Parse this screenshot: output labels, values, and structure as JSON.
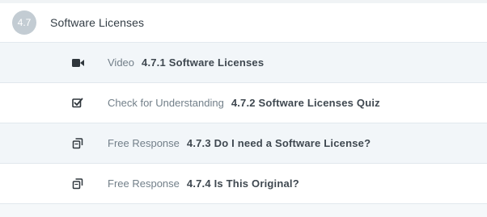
{
  "section": {
    "number": "4.7",
    "title": "Software Licenses"
  },
  "items": [
    {
      "icon": "video-camera-icon",
      "type": "Video",
      "title": "4.7.1 Software Licenses"
    },
    {
      "icon": "checkbox-icon",
      "type": "Check for Understanding",
      "title": "4.7.2 Software Licenses Quiz"
    },
    {
      "icon": "copy-pages-icon",
      "type": "Free Response",
      "title": "4.7.3 Do I need a Software License?"
    },
    {
      "icon": "copy-pages-icon",
      "type": "Free Response",
      "title": "4.7.4 Is This Original?"
    }
  ],
  "colors": {
    "badge": "#c3ccd3",
    "text_primary": "#3f4850",
    "text_secondary": "#727f89",
    "row_alt": "#f2f6f9"
  }
}
